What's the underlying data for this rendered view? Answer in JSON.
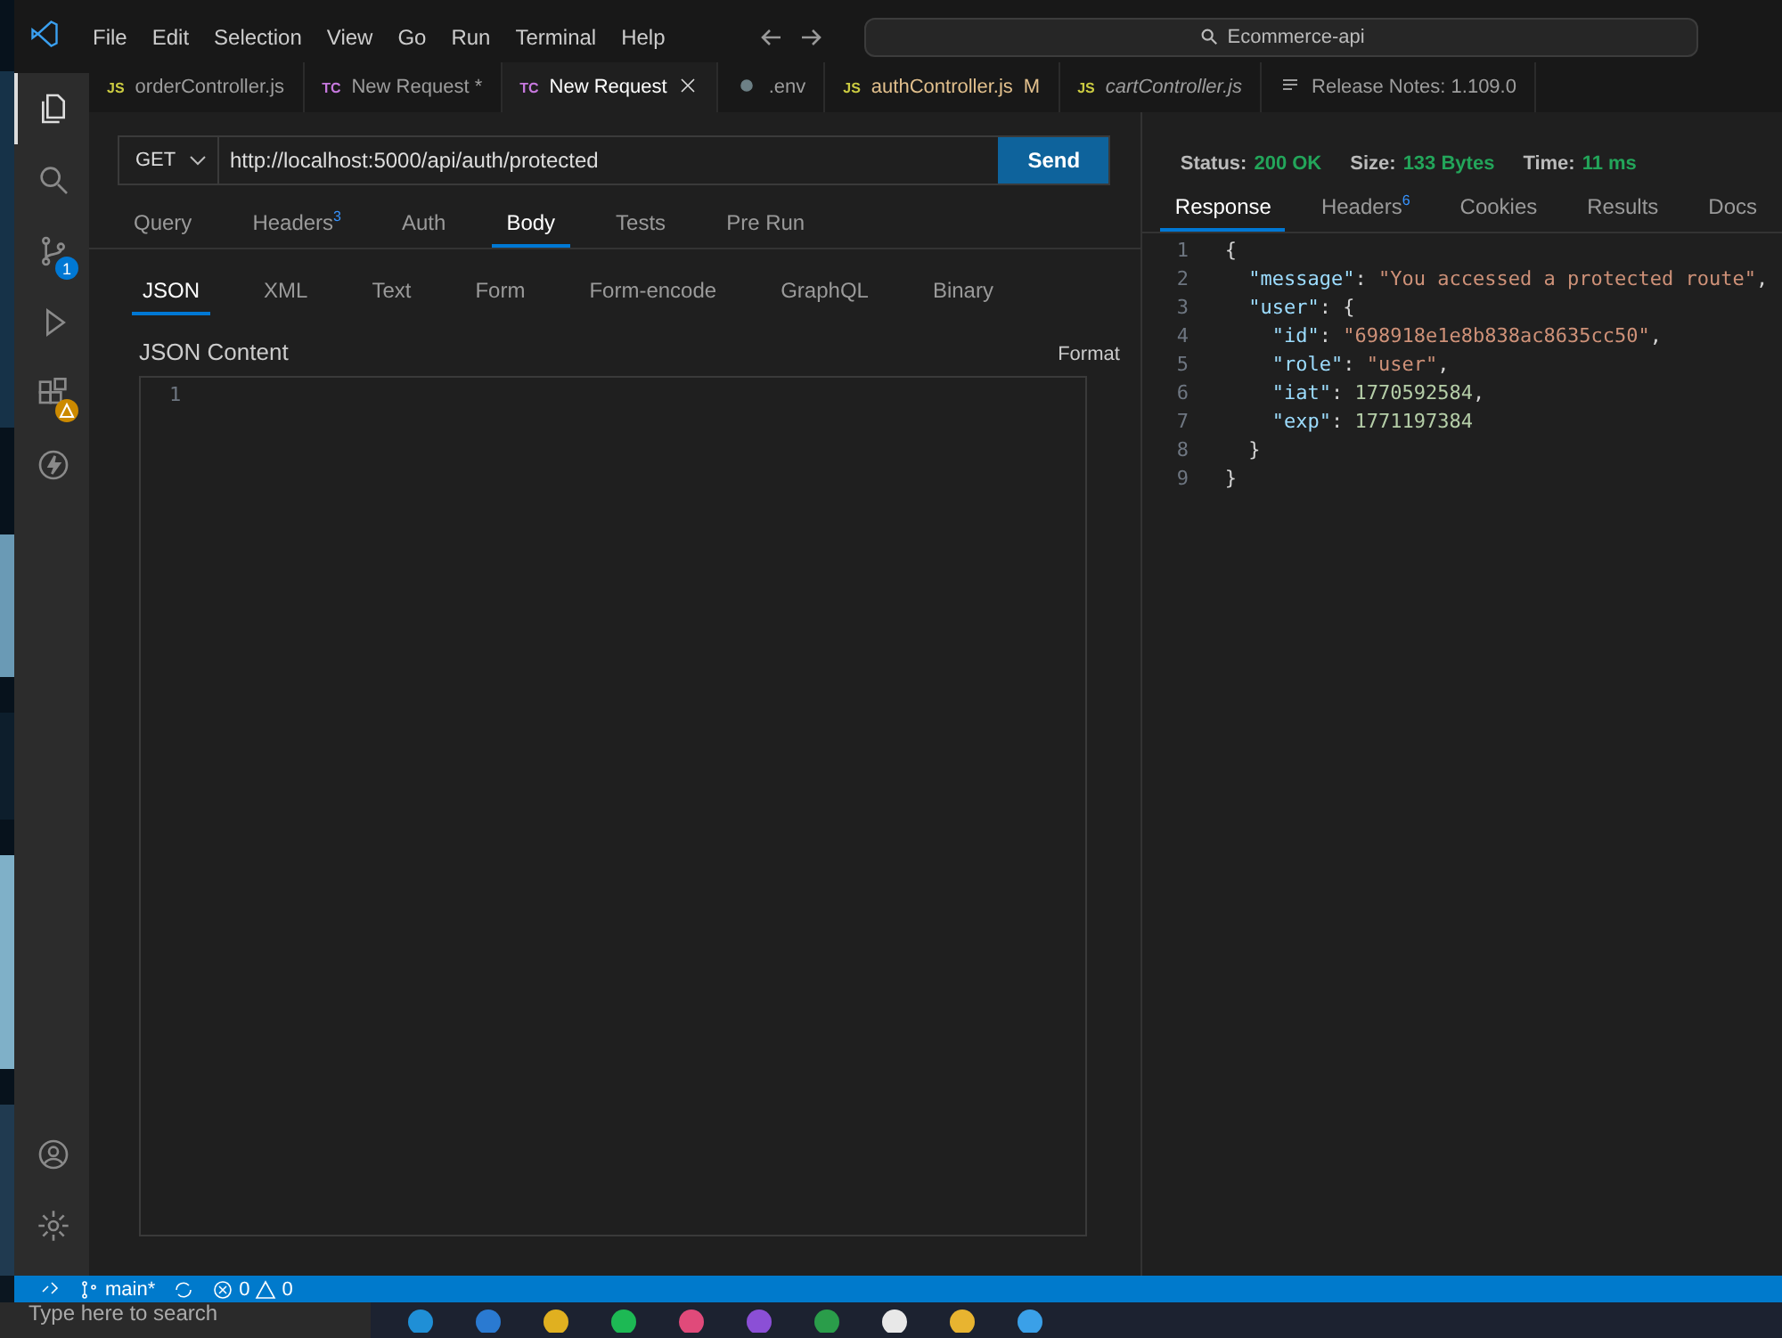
{
  "title_bar": {
    "menus": [
      "File",
      "Edit",
      "Selection",
      "View",
      "Go",
      "Run",
      "Terminal",
      "Help"
    ],
    "search": {
      "value": "Ecommerce-api"
    }
  },
  "activity_bar": {
    "items": [
      {
        "kind": "files",
        "selected": true
      },
      {
        "kind": "search",
        "selected": false
      },
      {
        "kind": "source-control",
        "selected": false,
        "badge": "1"
      },
      {
        "kind": "run-debug",
        "selected": false
      },
      {
        "kind": "extensions",
        "selected": false,
        "warning": true
      },
      {
        "kind": "thunder",
        "selected": false
      }
    ],
    "bottom": [
      {
        "kind": "account"
      },
      {
        "kind": "settings"
      }
    ]
  },
  "tabs": [
    {
      "kind": "js",
      "icon_text": "JS",
      "label": "orderController.js",
      "selected": false,
      "italic": false,
      "modified": false
    },
    {
      "kind": "tc",
      "icon_text": "TC",
      "label": "New Request *",
      "selected": false,
      "italic": false,
      "modified": false
    },
    {
      "kind": "tc",
      "icon_text": "TC",
      "label": "New Request",
      "selected": true,
      "italic": false,
      "modified": false
    },
    {
      "kind": "settings",
      "label": ".env",
      "selected": false,
      "italic": false,
      "modified": false
    },
    {
      "kind": "js",
      "icon_text": "JS",
      "label": "authController.js",
      "selected": false,
      "italic": false,
      "modified": true,
      "badge": "M"
    },
    {
      "kind": "js",
      "icon_text": "JS",
      "label": "cartController.js",
      "selected": false,
      "italic": true,
      "modified": false
    },
    {
      "kind": "notes",
      "label": "Release Notes: 1.109.0",
      "selected": false,
      "italic": false,
      "modified": false
    }
  ],
  "request": {
    "method": "GET",
    "url": "http://localhost:5000/api/auth/protected",
    "send": "Send",
    "tabs": [
      {
        "label": "Query",
        "selected": false
      },
      {
        "label": "Headers",
        "count": "3",
        "selected": false
      },
      {
        "label": "Auth",
        "selected": false
      },
      {
        "label": "Body",
        "selected": true
      },
      {
        "label": "Tests",
        "selected": false
      },
      {
        "label": "Pre Run",
        "selected": false
      }
    ],
    "body_types": [
      {
        "label": "JSON",
        "selected": true
      },
      {
        "label": "XML",
        "selected": false
      },
      {
        "label": "Text",
        "selected": false
      },
      {
        "label": "Form",
        "selected": false
      },
      {
        "label": "Form-encode",
        "selected": false
      },
      {
        "label": "GraphQL",
        "selected": false
      },
      {
        "label": "Binary",
        "selected": false
      }
    ],
    "content_label": "JSON Content",
    "format": "Format",
    "editor_lines": [
      "1"
    ]
  },
  "response": {
    "stats": [
      {
        "label": "Status:",
        "value": "200 OK"
      },
      {
        "label": "Size:",
        "value": "133 Bytes"
      },
      {
        "label": "Time:",
        "value": "11 ms"
      }
    ],
    "tabs": [
      {
        "label": "Response",
        "selected": true
      },
      {
        "label": "Headers",
        "count": "6",
        "selected": false
      },
      {
        "label": "Cookies",
        "selected": false
      },
      {
        "label": "Results",
        "selected": false
      },
      {
        "label": "Docs",
        "selected": false
      }
    ],
    "lines": [
      {
        "number": "1",
        "tokens": [
          {
            "kind": "punct",
            "text": "{"
          }
        ]
      },
      {
        "number": "2",
        "tokens": [
          {
            "kind": "key",
            "text": "  \"message\""
          },
          {
            "kind": "punct",
            "text": ": "
          },
          {
            "kind": "string",
            "text": "\"You accessed a protected route\""
          },
          {
            "kind": "punct",
            "text": ","
          }
        ]
      },
      {
        "number": "3",
        "tokens": [
          {
            "kind": "key",
            "text": "  \"user\""
          },
          {
            "kind": "punct",
            "text": ": {"
          }
        ]
      },
      {
        "number": "4",
        "tokens": [
          {
            "kind": "key",
            "text": "    \"id\""
          },
          {
            "kind": "punct",
            "text": ": "
          },
          {
            "kind": "string",
            "text": "\"698918e1e8b838ac8635cc50\""
          },
          {
            "kind": "punct",
            "text": ","
          }
        ]
      },
      {
        "number": "5",
        "tokens": [
          {
            "kind": "key",
            "text": "    \"role\""
          },
          {
            "kind": "punct",
            "text": ": "
          },
          {
            "kind": "string",
            "text": "\"user\""
          },
          {
            "kind": "punct",
            "text": ","
          }
        ]
      },
      {
        "number": "6",
        "tokens": [
          {
            "kind": "key",
            "text": "    \"iat\""
          },
          {
            "kind": "punct",
            "text": ": "
          },
          {
            "kind": "number",
            "text": "1770592584"
          },
          {
            "kind": "punct",
            "text": ","
          }
        ]
      },
      {
        "number": "7",
        "tokens": [
          {
            "kind": "key",
            "text": "    \"exp\""
          },
          {
            "kind": "punct",
            "text": ": "
          },
          {
            "kind": "number",
            "text": "1771197384"
          }
        ]
      },
      {
        "number": "8",
        "tokens": [
          {
            "kind": "punct",
            "text": "  }"
          }
        ]
      },
      {
        "number": "9",
        "tokens": [
          {
            "kind": "punct",
            "text": "}"
          }
        ]
      }
    ]
  },
  "status_bar": {
    "branch": "main*",
    "errors": "0",
    "warnings": "0"
  },
  "taskbar": {
    "search": "Type here to search",
    "apps": [
      {
        "color": "#1f8fd6"
      },
      {
        "color": "#2a7ad1"
      },
      {
        "color": "#e0b020"
      },
      {
        "color": "#1db954"
      },
      {
        "color": "#e04a7a"
      },
      {
        "color": "#8b4fd6"
      },
      {
        "color": "#2a9d4a"
      },
      {
        "color": "#e8e8e8"
      },
      {
        "color": "#e8b430"
      },
      {
        "color": "#3aa0e8"
      }
    ]
  }
}
